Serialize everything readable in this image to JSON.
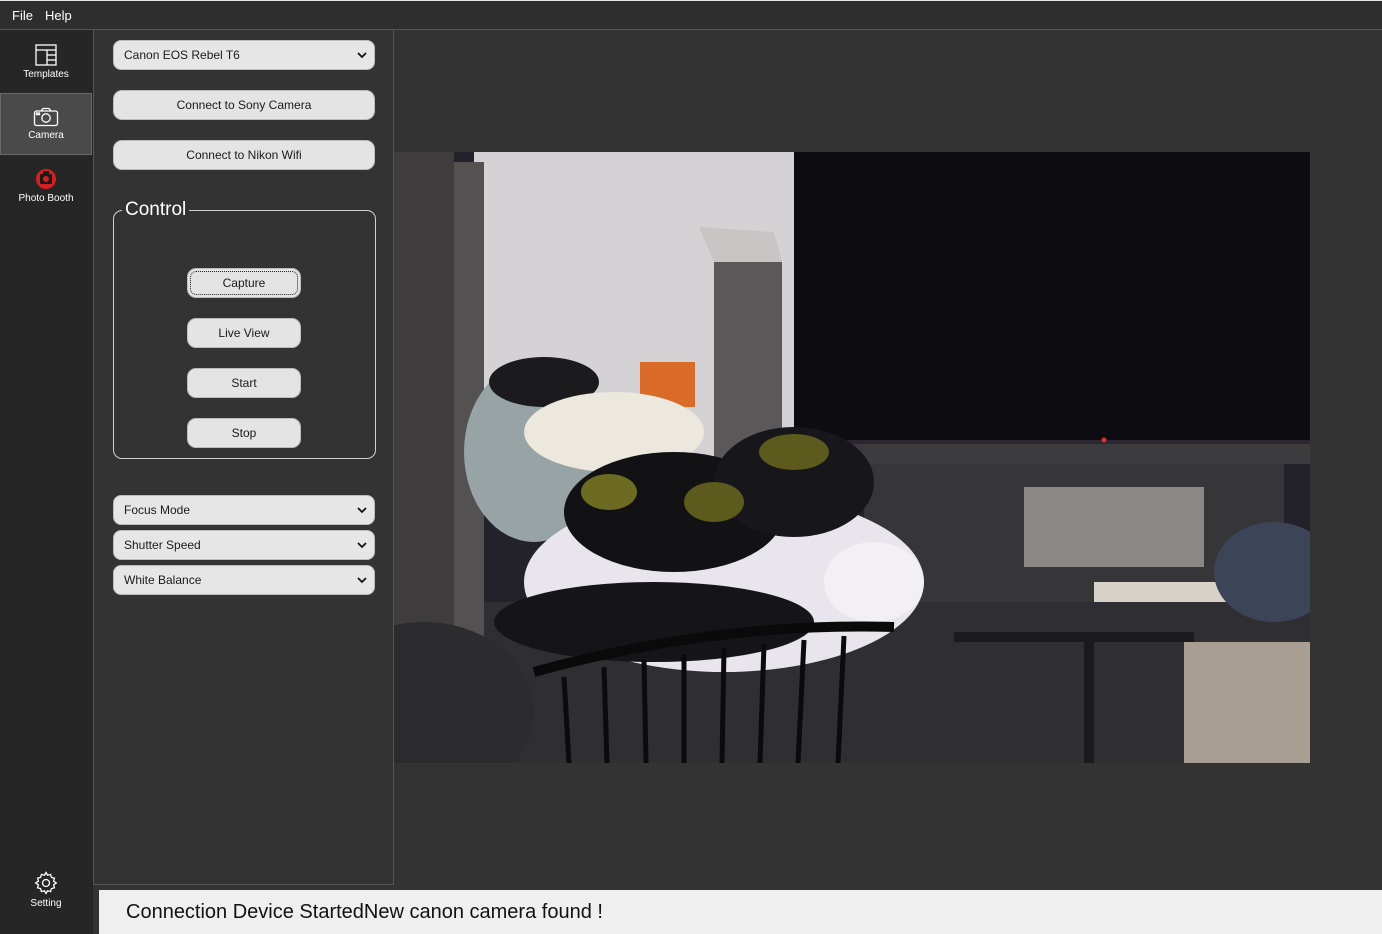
{
  "menu": {
    "file": "File",
    "help": "Help"
  },
  "sidebar": {
    "items": [
      {
        "label": "Templates",
        "icon": "templates-icon"
      },
      {
        "label": "Camera",
        "icon": "camera-icon",
        "active": true
      },
      {
        "label": "Photo Booth",
        "icon": "photo-booth-icon"
      }
    ],
    "settings": {
      "label": "Setting",
      "icon": "gear-icon"
    }
  },
  "panel": {
    "camera_select": "Canon EOS Rebel T6",
    "connect_sony": "Connect to Sony Camera",
    "connect_nikon": "Connect to Nikon Wifi",
    "control": {
      "title": "Control",
      "capture": "Capture",
      "live_view": "Live View",
      "start": "Start",
      "stop": "Stop"
    },
    "focus_mode": "Focus Mode",
    "shutter_speed": "Shutter Speed",
    "white_balance": "White Balance"
  },
  "status": {
    "message": "Connection Device StartedNew canon camera found !"
  },
  "colors": {
    "background": "#333333",
    "sidebar": "#262626",
    "photo_booth_icon": "#d42020"
  }
}
